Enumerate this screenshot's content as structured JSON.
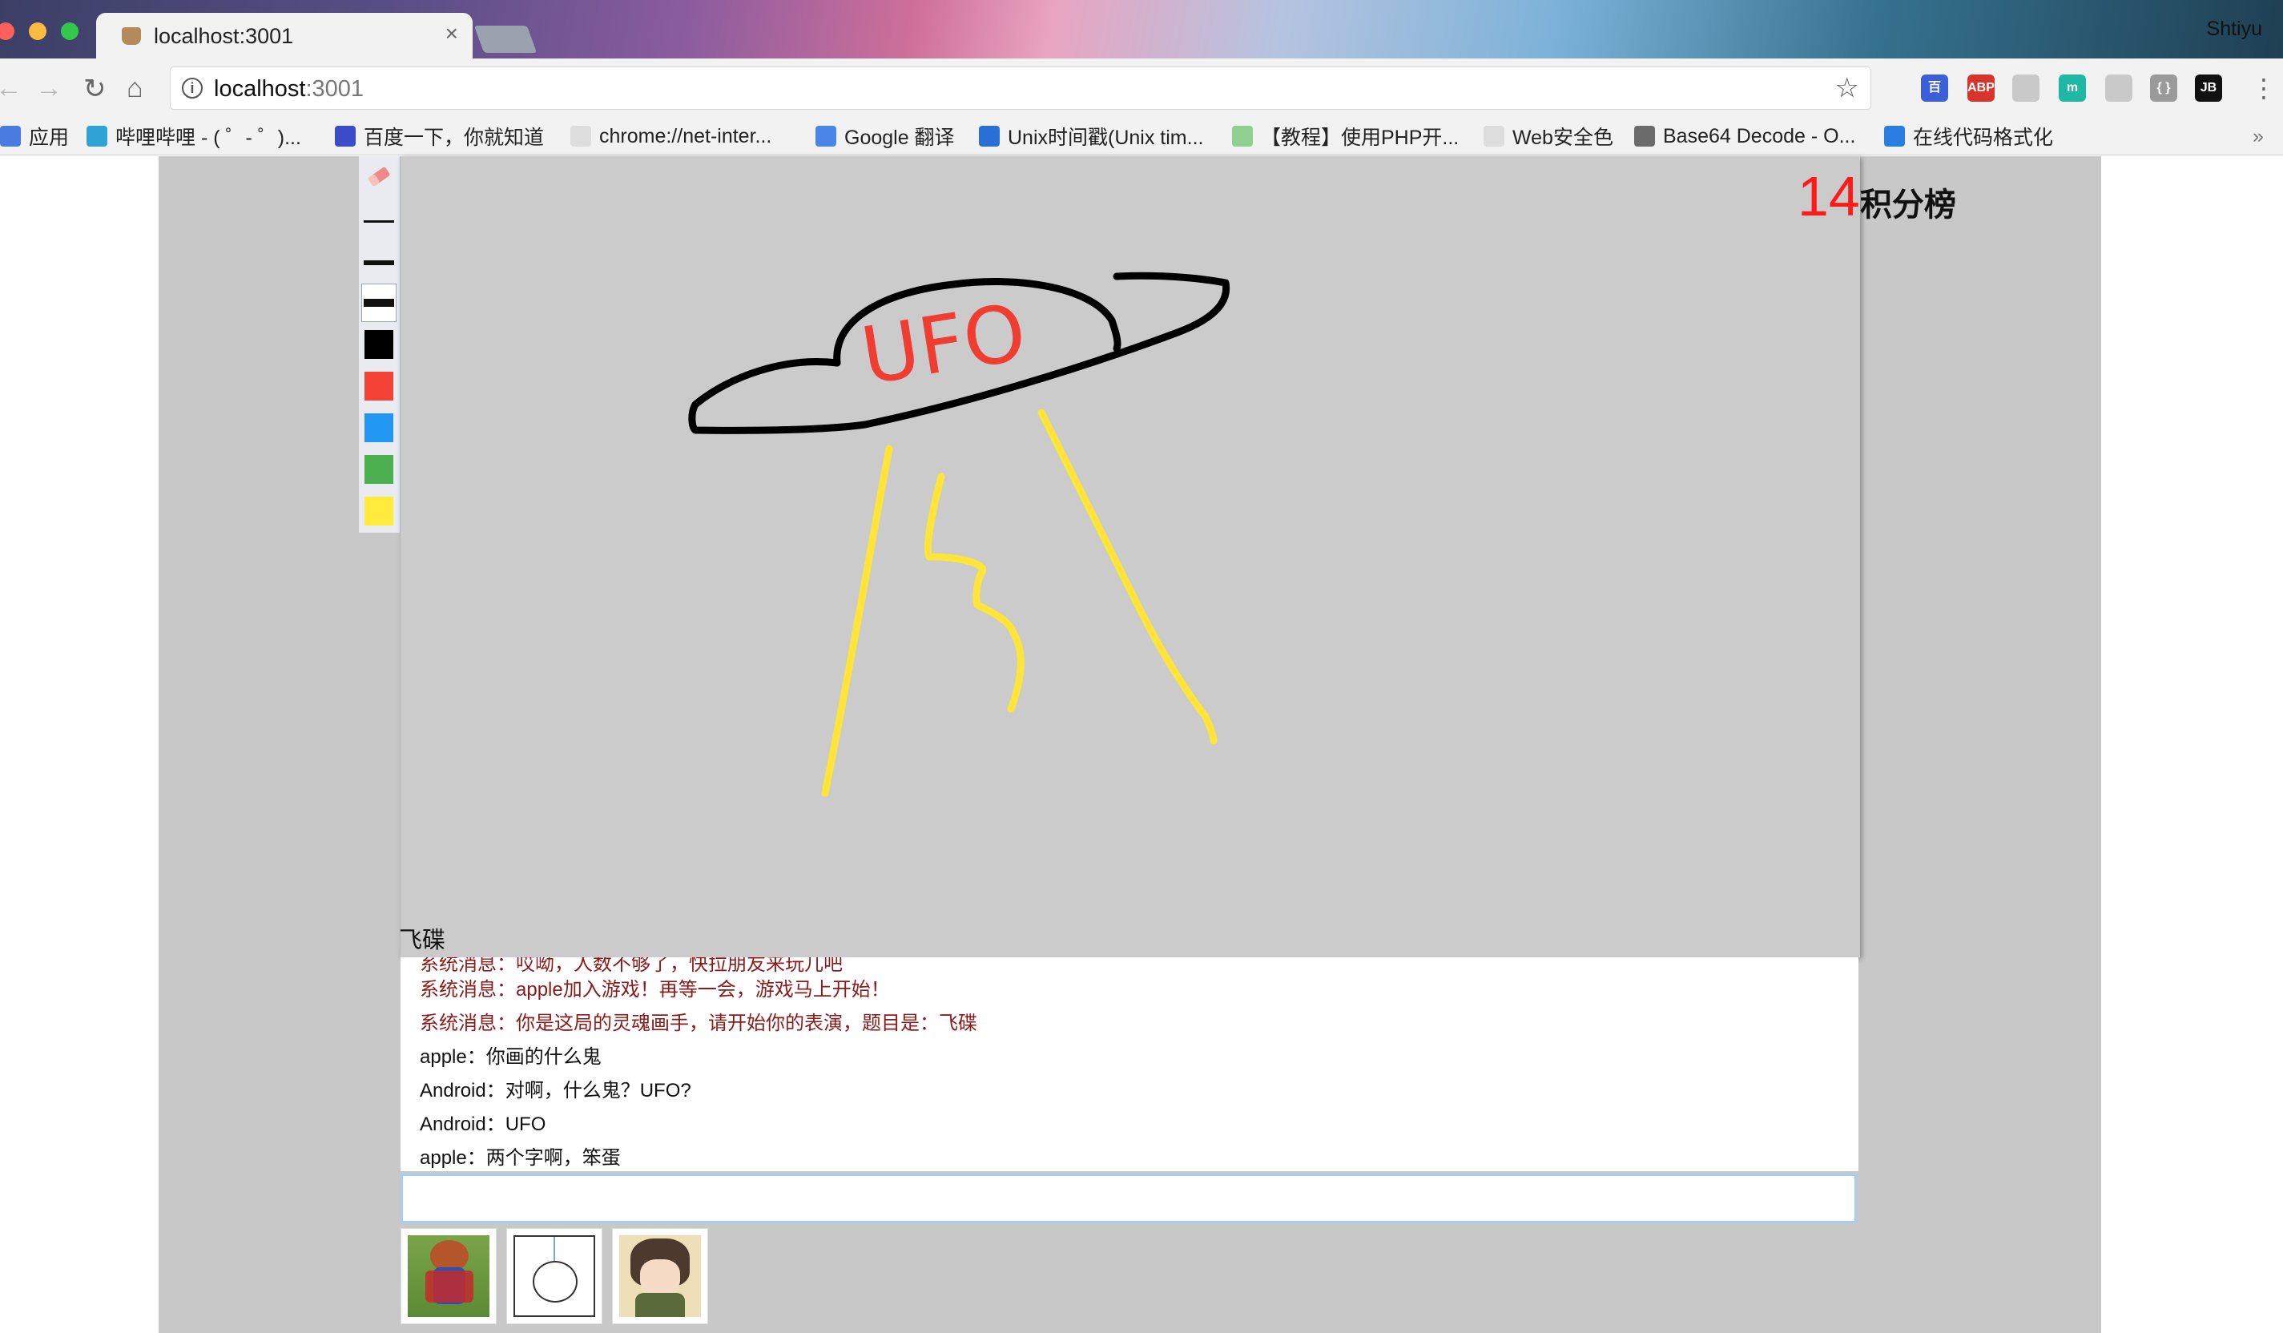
{
  "browser": {
    "tab_title": "localhost:3001",
    "tab_close": "×",
    "profile_name": "Shtiyu",
    "url_host": "localhost",
    "url_port": ":3001",
    "nav": {
      "back": "←",
      "forward": "→",
      "reload": "↻",
      "home": "⌂",
      "info": "i",
      "star": "☆"
    },
    "extensions": [
      {
        "name": "baidu-extension",
        "label": "百",
        "color": "#3b5fd9"
      },
      {
        "name": "abp-extension",
        "label": "ABP",
        "color": "#d9342b"
      },
      {
        "name": "reader-extension",
        "label": "",
        "color": "#c9c9c9"
      },
      {
        "name": "m-extension",
        "label": "m",
        "color": "#1fb8a5"
      },
      {
        "name": "shield-extension",
        "label": "",
        "color": "#c9c9c9"
      },
      {
        "name": "json-extension",
        "label": "{ }",
        "color": "#9a9a9a"
      },
      {
        "name": "jb-extension",
        "label": "JB",
        "color": "#111111"
      }
    ],
    "menu": "⋮"
  },
  "bookmarks": [
    {
      "name": "bookmark-apps",
      "label": "应用",
      "icon_color": "#4a7be0"
    },
    {
      "name": "bookmark-bilibili",
      "label": "哔哩哔哩 - ( ゜- ゜)...",
      "icon_color": "#2fa3d6"
    },
    {
      "name": "bookmark-baidu",
      "label": "百度一下，你就知道",
      "icon_color": "#3b4cca"
    },
    {
      "name": "bookmark-chrome-net",
      "label": "chrome://net-inter...",
      "icon_color": "#dddddd"
    },
    {
      "name": "bookmark-google-translate",
      "label": "Google 翻译",
      "icon_color": "#4a86e8"
    },
    {
      "name": "bookmark-unix-time",
      "label": "Unix时间戳(Unix tim...",
      "icon_color": "#2a6fd6"
    },
    {
      "name": "bookmark-php-tutorial",
      "label": "【教程】使用PHP开...",
      "icon_color": "#8fcf8f"
    },
    {
      "name": "bookmark-web-safe-colors",
      "label": "Web安全色",
      "icon_color": "#dddddd"
    },
    {
      "name": "bookmark-base64",
      "label": "Base64 Decode - O...",
      "icon_color": "#6b6b6b"
    },
    {
      "name": "bookmark-code-format",
      "label": "在线代码格式化",
      "icon_color": "#2a7de1"
    }
  ],
  "bookmarks_more": "»",
  "game": {
    "score": "14",
    "score_label": "积分榜",
    "hint": "飞碟",
    "colors": [
      "#000000",
      "#f44336",
      "#2196f3",
      "#4caf50",
      "#ffeb3b"
    ],
    "canvas_label": "UFO",
    "messages": [
      {
        "type": "sys",
        "text": "系统消息：哎呦，人数不够了，快拉朋友来玩儿吧"
      },
      {
        "type": "sys",
        "text": "系统消息：apple加入游戏！再等一会，游戏马上开始！"
      },
      {
        "type": "sys",
        "text": "系统消息：你是这局的灵魂画手，请开始你的表演，题目是：飞碟"
      },
      {
        "type": "user",
        "text": "apple：你画的什么鬼"
      },
      {
        "type": "user",
        "text": "Android：对啊，什么鬼？UFO?"
      },
      {
        "type": "user",
        "text": "Android：UFO"
      },
      {
        "type": "user",
        "text": "apple：两个字啊，笨蛋"
      }
    ],
    "chat_input_value": "",
    "players": [
      {
        "name": "player-avatar-superman"
      },
      {
        "name": "player-avatar-sketch"
      },
      {
        "name": "player-avatar-anime"
      }
    ]
  }
}
